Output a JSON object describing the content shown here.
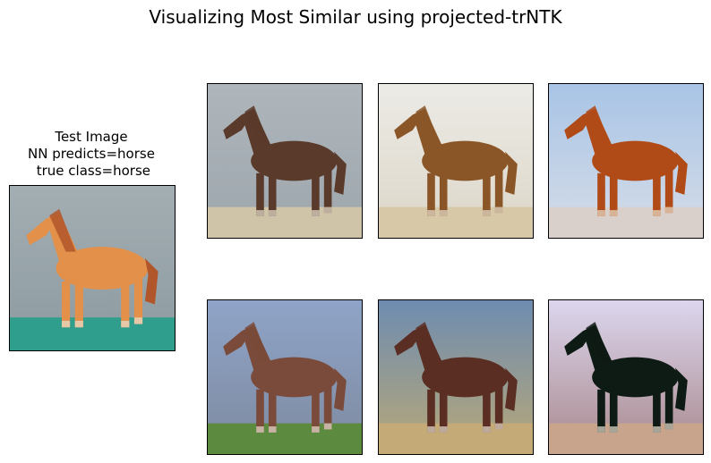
{
  "figure": {
    "title": "Visualizing Most Similar using projected-trNTK"
  },
  "test_panel": {
    "caption_line1": "Test Image",
    "caption_line2": "NN predicts=horse",
    "caption_line3": " true class=horse",
    "colors": {
      "bg_top": "#a3aeb2",
      "bg_bottom": "#8c9aa0",
      "ground": "#2f9e8c",
      "horse": "#e2904a",
      "mane": "#b0562a"
    }
  },
  "similar_images": [
    {
      "colors": {
        "bg_top": "#aeb6bc",
        "bg_bottom": "#9ea6ad",
        "ground": "#cfc4a8",
        "horse": "#5a3a2a"
      }
    },
    {
      "colors": {
        "bg_top": "#ecebe6",
        "bg_bottom": "#dcd6c8",
        "ground": "#d7c8a8",
        "horse": "#8a5628"
      }
    },
    {
      "colors": {
        "bg_top": "#a8c4e6",
        "bg_bottom": "#d6dde8",
        "ground": "#d9d0cc",
        "horse": "#b04a16"
      }
    },
    {
      "colors": {
        "bg_top": "#8fa4c8",
        "bg_bottom": "#7e8aa0",
        "ground": "#5c8a3e",
        "horse": "#7a4a3a"
      }
    },
    {
      "colors": {
        "bg_top": "#6e8cb0",
        "bg_bottom": "#b8a878",
        "ground": "#c4aa76",
        "horse": "#5a2e22"
      }
    },
    {
      "colors": {
        "bg_top": "#dcd6ee",
        "bg_bottom": "#a8888c",
        "ground": "#c8a48c",
        "horse": "#0e1a14"
      }
    }
  ]
}
